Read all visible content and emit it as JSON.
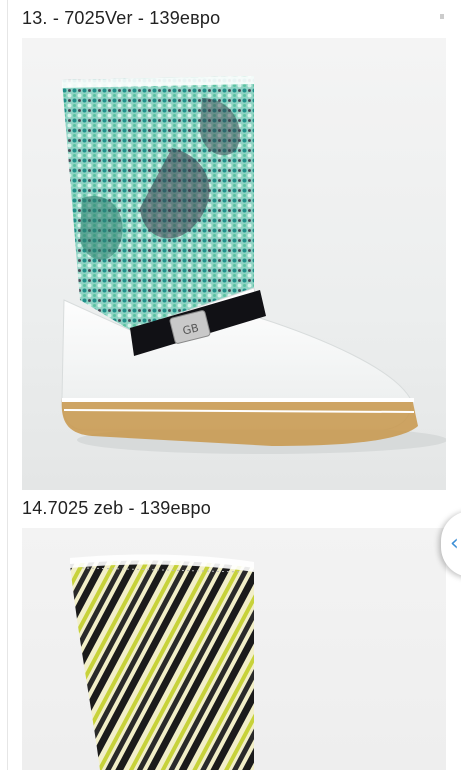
{
  "items": [
    {
      "caption": "13. - 7025Ver - 139евро",
      "image": "white-boot-green-blue-python-shaft"
    },
    {
      "caption": "14.7025 zeb - 139евро",
      "image": "boot-zebra-yellow-shaft"
    }
  ],
  "scroll_control": {
    "icon": "chevron-left-icon",
    "glyph": "‹",
    "color": "#3d8fd6"
  }
}
